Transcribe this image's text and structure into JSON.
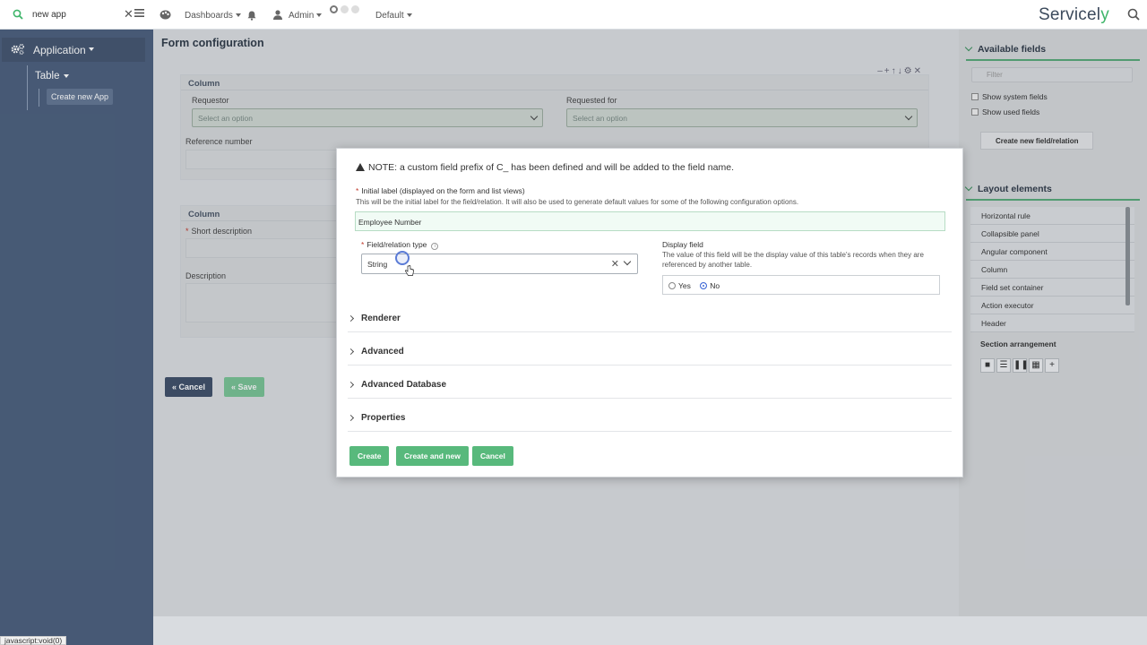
{
  "topbar": {
    "search_value": "new app",
    "nav": [
      "Dashboards",
      "Admin",
      "Default"
    ],
    "logo_main": "Servicel",
    "logo_accent": "y"
  },
  "sidebar": {
    "application_label": "Application",
    "table_label": "Table",
    "create_app_label": "Create new App"
  },
  "main": {
    "title": "Form configuration",
    "column1": {
      "heading": "Column",
      "requestor_label": "Requestor",
      "requestor_placeholder": "Select an option",
      "requested_for_label": "Requested for",
      "requested_for_placeholder": "Select an option",
      "reference_label": "Reference number"
    },
    "column2": {
      "heading": "Column",
      "short_desc_label": "Short description",
      "description_label": "Description"
    },
    "cancel_label": "Cancel",
    "save_label": "Save"
  },
  "right_panel": {
    "available_fields_title": "Available fields",
    "search_placeholder": "Filter",
    "show_system_fields": "Show system fields",
    "show_used_fields": "Show used fields",
    "create_field_label": "Create new field/relation",
    "layout_title": "Layout elements",
    "layout_items": [
      "Horizontal rule",
      "Collapsible panel",
      "Angular component",
      "Column",
      "Field set container",
      "Action executor",
      "Header"
    ],
    "section_arrangement": "Section arrangement"
  },
  "modal": {
    "note": "NOTE: a custom field prefix of C_ has been defined and will be added to the field name.",
    "initial_label_title": "Initial label (displayed on the form and list views)",
    "initial_label_hint": "This will be the initial label for the field/relation. It will also be used to generate default values for some of the following configuration options.",
    "initial_label_value": "Employee Number",
    "type_label": "Field/relation type",
    "type_value": "String",
    "display_field_label": "Display field",
    "display_field_hint": "The value of this field will be the display value of this table's records when they are referenced by another table.",
    "yes_label": "Yes",
    "no_label": "No",
    "display_field_selected": "No",
    "sections": [
      "Renderer",
      "Advanced",
      "Advanced Database",
      "Properties"
    ],
    "create_label": "Create",
    "create_new_label": "Create and new",
    "cancel_label": "Cancel"
  },
  "status_bar": "javascript:void(0)",
  "colors": {
    "accent_green": "#58b97c",
    "sidebar": "#4b5e7c",
    "cancel_btn": "#3f4f68"
  }
}
